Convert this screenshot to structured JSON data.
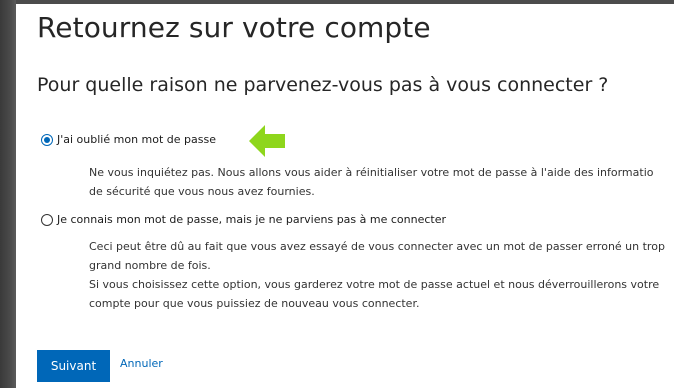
{
  "page": {
    "title": "Retournez sur votre compte",
    "question": "Pour quelle raison ne parvenez-vous pas à vous connecter ?"
  },
  "options": [
    {
      "label": "J'ai oublié mon mot de passe",
      "selected": true,
      "description": [
        "Ne vous inquiétez pas. Nous allons vous aider à réinitialiser votre mot de passe à l'aide des informatio",
        "de sécurité que vous nous avez fournies."
      ]
    },
    {
      "label": "Je connais mon mot de passe, mais je ne parviens pas à me connecter",
      "selected": false,
      "description": [
        "Ceci peut être dû au fait que vous avez essayé de vous connecter avec un mot de passer erroné un trop",
        "grand nombre de fois.",
        "Si vous choisissez cette option, vous garderez votre mot de passe actuel et nous déverrouillerons votre",
        "compte pour que vous puissiez de nouveau vous connecter."
      ]
    }
  ],
  "actions": {
    "next_label": "Suivant",
    "cancel_label": "Annuler"
  },
  "annotation": {
    "icon": "arrow-left-icon",
    "color": "#8ed61c"
  },
  "colors": {
    "accent": "#0067b8",
    "text": "#262626"
  }
}
